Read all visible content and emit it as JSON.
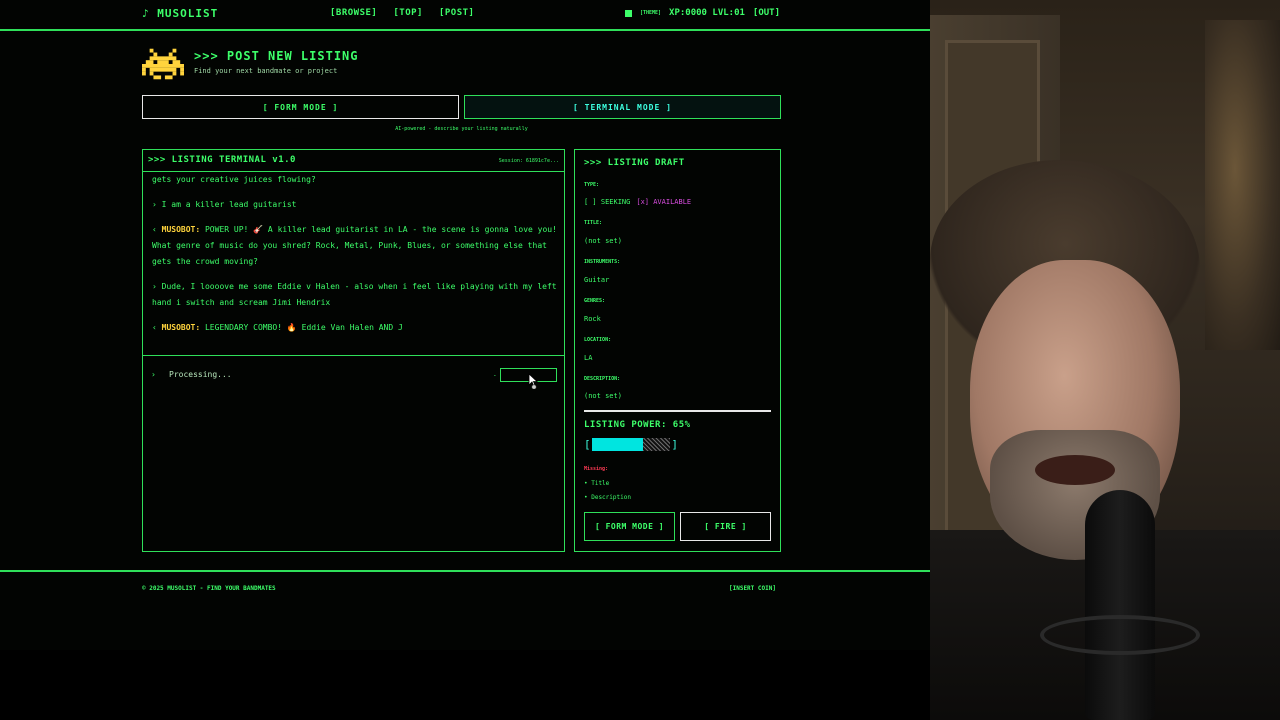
{
  "nav": {
    "logo": "♪ MUSOLIST",
    "links": [
      "[BROWSE]",
      "[TOP]",
      "[POST]"
    ],
    "theme_label": "[THEME]",
    "stats": "XP:0000 LVL:01",
    "out": "[OUT]"
  },
  "header": {
    "title": ">>> POST NEW LISTING",
    "subtitle": "Find your next bandmate or project"
  },
  "modes": {
    "form": "[ FORM MODE ]",
    "terminal": "[ TERMINAL MODE ]",
    "note": "AI-powered - describe your listing naturally"
  },
  "terminal": {
    "title": ">>> LISTING TERMINAL v1.0",
    "session": "Session: 61891c7e...",
    "messages": [
      {
        "prefix": "",
        "name": "",
        "text": "gets your creative juices flowing?"
      },
      {
        "prefix": "› ",
        "name": "",
        "text": "I am a killer lead guitarist"
      },
      {
        "prefix": "‹ ",
        "name": "MUSOBOT:",
        "text": " POWER UP! 🎸 A killer lead guitarist in LA - the scene is gonna love you! What genre of music do you shred? Rock, Metal, Punk, Blues, or something else that gets the crowd moving?"
      },
      {
        "prefix": "› ",
        "name": "",
        "text": "Dude, I loooove me some Eddie v Halen - also when i feel like playing with my left hand i switch and scream Jimi Hendrix"
      },
      {
        "prefix": "‹ ",
        "name": "MUSOBOT:",
        "text": " LEGENDARY COMBO! 🔥 Eddie Van Halen AND J"
      }
    ],
    "prompt_chevron": "›",
    "prompt_text": "Processing...",
    "send_dash": "-"
  },
  "draft": {
    "title": ">>> LISTING DRAFT",
    "type_label": "TYPE:",
    "type_seeking": "[ ] SEEKING",
    "type_available": "[x] AVAILABLE",
    "title_label": "TITLE:",
    "title_value": "(not set)",
    "instruments_label": "INSTRUMENTS:",
    "instruments_value": "Guitar",
    "genres_label": "GENRES:",
    "genres_value": "Rock",
    "location_label": "LOCATION:",
    "location_value": "LA",
    "description_label": "DESCRIPTION:",
    "description_value": "(not set)",
    "power_label": "LISTING POWER: 65%",
    "power_percent": 65,
    "bracket_open": "[",
    "bracket_close": "]",
    "missing_label": "Missing:",
    "missing_items": [
      "• Title",
      "• Description"
    ],
    "form_mode_button": "[ FORM MODE ]",
    "fire_button": "[ FIRE ]"
  },
  "footer": {
    "left": "© 2025 MUSOLIST - FIND YOUR BANDMATES",
    "right": "[INSERT COIN]"
  },
  "colors": {
    "accent": "#3dff6a",
    "cyan": "#3dffe0",
    "bot_name": "#ffd43d",
    "available": "#d94de0",
    "missing": "#ff3b55"
  }
}
